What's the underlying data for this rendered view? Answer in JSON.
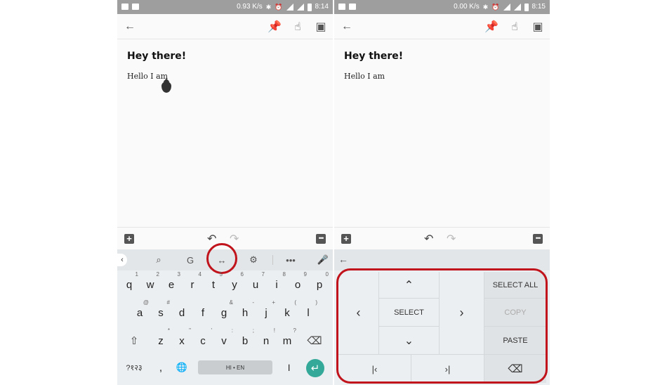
{
  "left": {
    "status": {
      "speed": "0.93 K/s",
      "time": "8:14"
    },
    "note": {
      "title": "Hey there!",
      "body": "Hello I am"
    },
    "strip": {
      "back": "‹",
      "search": "🔍",
      "translate": "G",
      "cursor": "↔",
      "gear": "⚙",
      "more": "•••",
      "mic": "🎙"
    },
    "rows": [
      {
        "keys": [
          "q",
          "w",
          "e",
          "r",
          "t",
          "y",
          "u",
          "i",
          "o",
          "p"
        ],
        "sups": [
          "1",
          "2",
          "3",
          "4",
          "5",
          "6",
          "7",
          "8",
          "9",
          "0"
        ]
      },
      {
        "keys": [
          "a",
          "s",
          "d",
          "f",
          "g",
          "h",
          "j",
          "k",
          "l"
        ],
        "sups": [
          "@",
          "#",
          "",
          "",
          "&",
          "-",
          "+",
          "(",
          ")"
        ]
      },
      {
        "keys": [
          "z",
          "x",
          "c",
          "v",
          "b",
          "n",
          "m"
        ],
        "sups": [
          "*",
          "\"",
          "'",
          ":",
          ";",
          "!",
          "?"
        ]
      }
    ],
    "bottom": {
      "sym": "?१२३",
      "comma": ",",
      "globe": "🌐",
      "space": "HI • EN",
      "period": "।",
      "enter": "↵"
    }
  },
  "right": {
    "status": {
      "speed": "0.00 K/s",
      "time": "8:15"
    },
    "note": {
      "title": "Hey there!",
      "body": "Hello I am"
    },
    "panel": {
      "up": "⌃",
      "down": "⌄",
      "left": "‹",
      "right": "›",
      "select": "SELECT",
      "select_all": "SELECT ALL",
      "copy": "COPY",
      "paste": "PASTE",
      "home": "|‹",
      "end": "›|",
      "backspace": "⌫"
    }
  },
  "colors": {
    "highlight": "#c0131b",
    "accent": "#34a999",
    "keyboard_bg": "#eceff1"
  }
}
